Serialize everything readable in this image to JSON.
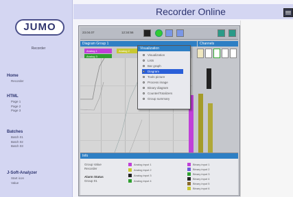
{
  "app_title": "Recorder Online",
  "sidebar": {
    "logo": "JUMO",
    "subtitle": "Recorder",
    "groups": [
      {
        "title": "Home",
        "links": [
          "Recorder"
        ]
      },
      {
        "title": "HTML",
        "links": [
          "Page 1",
          "Page 2",
          "Page 3"
        ]
      },
      {
        "title": "Batches",
        "links": [
          "Batch 01",
          "Batch 02",
          "Batch 03"
        ]
      },
      {
        "title": "J-Soft-Analyzer",
        "links": [
          "Start icon",
          "Value"
        ]
      }
    ]
  },
  "toolbar": {
    "date": "23.04.07",
    "time": "12:34:56"
  },
  "chart": {
    "header": "Diagram Group 1",
    "channel_header": "Channels",
    "legend": [
      {
        "label": "Analog 1",
        "color": "#c040d8"
      },
      {
        "label": "Analog 2",
        "color": "#c8c830"
      },
      {
        "label": "Analog 3",
        "color": "#30a030"
      }
    ]
  },
  "popup": {
    "title": "Visualization",
    "items": [
      "Visualization",
      "Lists",
      "Bar graph",
      "Diagram",
      "Tools picture",
      "Process image",
      "Binary diagram",
      "Counter/Totalizers",
      "Group summary"
    ],
    "selected_index": 3
  },
  "info_panel": {
    "header": "Info",
    "left_lines": [
      "Group Value",
      "Recorder"
    ],
    "status_label": "Alarm Status",
    "status_value": "Group 01",
    "analog": [
      "Analog input 1",
      "Analog input 2",
      "Analog input 3",
      "Analog input 4"
    ],
    "binary": [
      "Binary input 1",
      "Binary input 2",
      "Binary input 3",
      "Binary input 4",
      "Binary input 5",
      "Binary input 6"
    ]
  }
}
